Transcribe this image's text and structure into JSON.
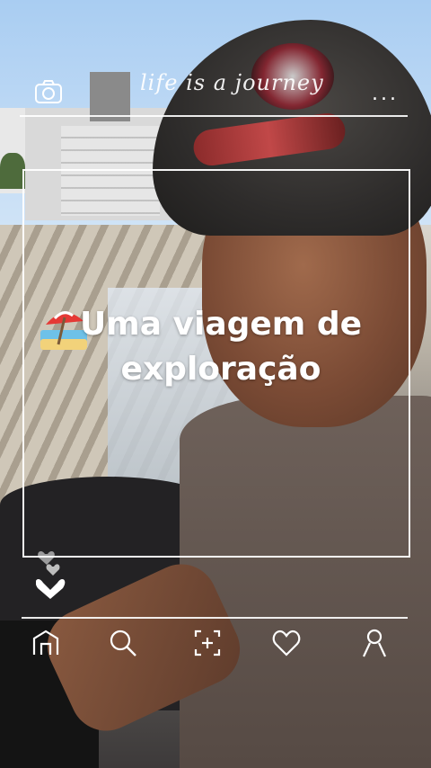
{
  "header": {
    "camera_icon": "camera-icon",
    "tagline": "life is a journey",
    "more_icon": "more-dots-icon",
    "more_label": "..."
  },
  "post": {
    "emoji": "beach-umbrella-icon",
    "headline_line1": "Uma viagem de",
    "headline_line2": "exploração"
  },
  "likes": {
    "icon": "hearts-icon"
  },
  "bottom_nav": [
    {
      "name": "home-icon"
    },
    {
      "name": "search-icon"
    },
    {
      "name": "add-post-icon"
    },
    {
      "name": "heart-icon"
    },
    {
      "name": "profile-icon"
    }
  ],
  "colors": {
    "overlay": "#ffffff"
  }
}
